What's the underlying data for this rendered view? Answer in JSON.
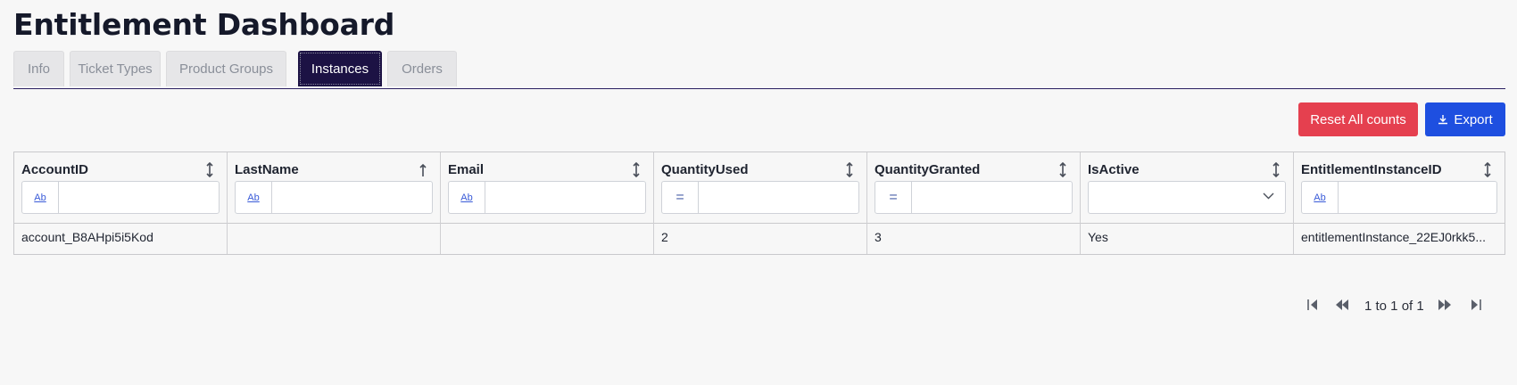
{
  "page": {
    "title": "Entitlement Dashboard"
  },
  "tabs": [
    {
      "label": "Info",
      "active": false
    },
    {
      "label": "Ticket Types",
      "active": false
    },
    {
      "label": "Product Groups",
      "active": false
    },
    {
      "label": "Instances",
      "active": true
    },
    {
      "label": "Orders",
      "active": false
    }
  ],
  "toolbar": {
    "reset_label": "Reset All counts",
    "export_label": "Export",
    "export_icon": "download-icon"
  },
  "grid": {
    "columns": [
      {
        "header": "AccountID",
        "filter_type": "text",
        "filter_type_label": "Ab",
        "filter_value": "",
        "sort_icon": "sort-both-icon"
      },
      {
        "header": "LastName",
        "filter_type": "text",
        "filter_type_label": "Ab",
        "filter_value": "",
        "sort_icon": "sort-ascending-icon"
      },
      {
        "header": "Email",
        "filter_type": "text",
        "filter_type_label": "Ab",
        "filter_value": "",
        "sort_icon": "sort-both-icon"
      },
      {
        "header": "QuantityUsed",
        "filter_type": "number",
        "filter_type_label": "=",
        "filter_value": "",
        "sort_icon": "sort-both-icon"
      },
      {
        "header": "QuantityGranted",
        "filter_type": "number",
        "filter_type_label": "=",
        "filter_value": "",
        "sort_icon": "sort-both-icon"
      },
      {
        "header": "IsActive",
        "filter_type": "select",
        "filter_value": "",
        "sort_icon": "sort-both-icon"
      },
      {
        "header": "EntitlementInstanceID",
        "filter_type": "text",
        "filter_type_label": "Ab",
        "filter_value": "",
        "sort_icon": "sort-both-icon"
      }
    ],
    "rows": [
      [
        "account_B8AHpi5i5Kod",
        "",
        "",
        "2",
        "3",
        "Yes",
        "entitlementInstance_22EJ0rkk5..."
      ]
    ]
  },
  "pagination": {
    "summary": "1 to 1 of 1"
  }
}
